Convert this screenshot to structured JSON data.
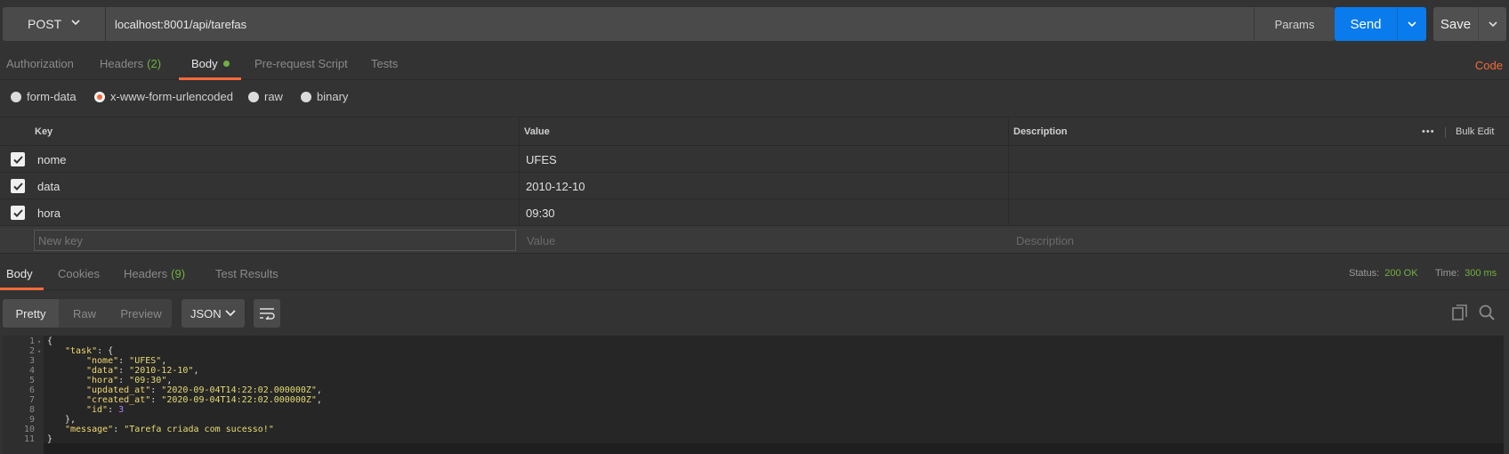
{
  "request": {
    "method": "POST",
    "url": "localhost:8001/api/tarefas",
    "params_label": "Params",
    "send_label": "Send",
    "save_label": "Save"
  },
  "request_tabs": {
    "authorization": "Authorization",
    "headers": "Headers",
    "headers_count": "(2)",
    "body": "Body",
    "prerequest": "Pre-request Script",
    "tests": "Tests",
    "code": "Code"
  },
  "body_types": {
    "form_data": "form-data",
    "urlencoded": "x-www-form-urlencoded",
    "raw": "raw",
    "binary": "binary",
    "selected": "x-www-form-urlencoded"
  },
  "kv_table": {
    "headers": {
      "key": "Key",
      "value": "Value",
      "description": "Description"
    },
    "more": "•••",
    "bulk_edit": "Bulk Edit",
    "rows": [
      {
        "key": "nome",
        "value": "UFES",
        "checked": true
      },
      {
        "key": "data",
        "value": "2010-12-10",
        "checked": true
      },
      {
        "key": "hora",
        "value": "09:30",
        "checked": true
      }
    ],
    "new_row": {
      "key_placeholder": "New key",
      "value_placeholder": "Value",
      "description_placeholder": "Description"
    }
  },
  "response_tabs": {
    "body": "Body",
    "cookies": "Cookies",
    "headers": "Headers",
    "headers_count": "(9)",
    "test_results": "Test Results",
    "status_label": "Status:",
    "status_value": "200 OK",
    "time_label": "Time:",
    "time_value": "300 ms"
  },
  "response_toolbar": {
    "pretty": "Pretty",
    "raw": "Raw",
    "preview": "Preview",
    "format": "JSON"
  },
  "code_lines": [
    {
      "n": "1",
      "fold": true
    },
    {
      "n": "2",
      "fold": true
    },
    {
      "n": "3"
    },
    {
      "n": "4"
    },
    {
      "n": "5"
    },
    {
      "n": "6"
    },
    {
      "n": "7"
    },
    {
      "n": "8"
    },
    {
      "n": "9"
    },
    {
      "n": "10"
    },
    {
      "n": "11"
    }
  ],
  "response_json": {
    "task": {
      "nome": "UFES",
      "data": "2010-12-10",
      "hora": "09:30",
      "updated_at": "2020-09-04T14:22:02.000000Z",
      "created_at": "2020-09-04T14:22:02.000000Z",
      "id": "3"
    },
    "message": "Tarefa criada com sucesso!"
  },
  "colors": {
    "accent": "#f26b3a",
    "send": "#097bed",
    "success": "#70b040"
  }
}
